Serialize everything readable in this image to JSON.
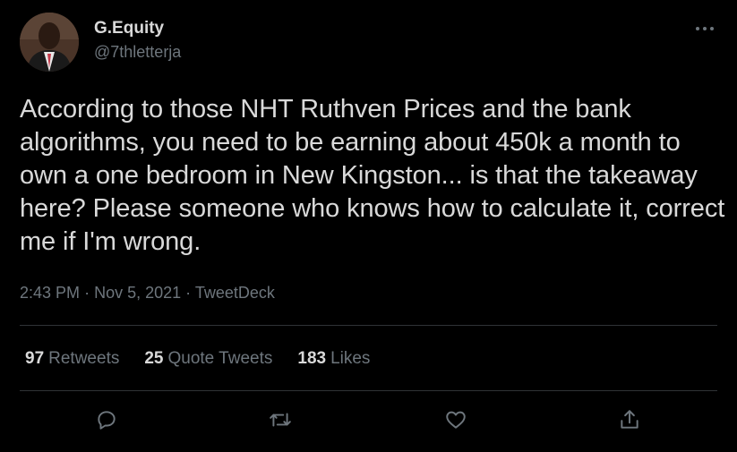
{
  "author": {
    "display_name": "G.Equity",
    "handle": "@7thletterja"
  },
  "tweet": {
    "text": "According to those NHT Ruthven Prices and the bank algorithms, you need to be earning about 450k a month to own a one bedroom in New Kingston... is that the takeaway here? Please someone who knows how to calculate it, correct me if I'm wrong.",
    "time": "2:43 PM",
    "separator": "·",
    "date": "Nov 5, 2021",
    "source": "TweetDeck"
  },
  "stats": {
    "retweets_count": "97",
    "retweets_label": "Retweets",
    "quotes_count": "25",
    "quotes_label": "Quote Tweets",
    "likes_count": "183",
    "likes_label": "Likes"
  },
  "actions": [
    "reply-icon",
    "retweet-icon",
    "like-icon",
    "share-icon"
  ],
  "colors": {
    "background": "#000000",
    "text": "#d9d9d9",
    "secondary": "#6e767d",
    "divider": "#2f3336"
  }
}
